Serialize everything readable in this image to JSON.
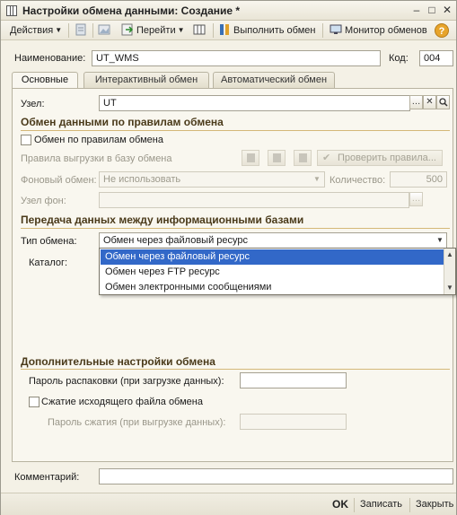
{
  "window": {
    "title": "Настройки обмена данными: Создание *",
    "controls": {
      "minimize": "–",
      "maximize": "□",
      "close": "✕"
    }
  },
  "toolbar": {
    "actions_label": "Действия",
    "goto_label": "Перейти",
    "execute_label": "Выполнить обмен",
    "monitor_label": "Монитор обменов",
    "help_label": "?"
  },
  "header": {
    "name_label": "Наименование:",
    "name_value": "UT_WMS",
    "code_label": "Код:",
    "code_value": "004"
  },
  "tabs": [
    {
      "label": "Основные",
      "active": true
    },
    {
      "label": "Интерактивный обмен",
      "active": false
    },
    {
      "label": "Автоматический обмен",
      "active": false
    }
  ],
  "main": {
    "node_label": "Узел:",
    "node_value": "UT",
    "rules_section": {
      "title": "Обмен данными по правилам обмена",
      "checkbox_label": "Обмен по правилам обмена",
      "checked": false,
      "upload_rules_label": "Правила выгрузки в базу обмена",
      "check_rules_label": "Проверить правила...",
      "bg_exchange_label": "Фоновый обмен:",
      "bg_exchange_value": "Не использовать",
      "quantity_label": "Количество:",
      "quantity_value": "500",
      "bg_node_label": "Узел фон:"
    },
    "transfer_section": {
      "title": "Передача данных между информационными базами",
      "exchange_type_label": "Тип обмена:",
      "exchange_type_value": "Обмен через файловый ресурс",
      "catalog_label": "Каталог:",
      "options": [
        "Обмен через файловый ресурс",
        "Обмен через FTP ресурс",
        "Обмен электронными сообщениями"
      ],
      "selected_index": 0
    },
    "extra_section": {
      "title": "Дополнительные настройки обмена",
      "unpack_password_label": "Пароль распаковки (при загрузке данных):",
      "compress_label": "Сжатие исходящего файла обмена",
      "compress_checked": false,
      "compress_password_label": "Пароль сжатия (при выгрузке данных):"
    }
  },
  "comment": {
    "label": "Комментарий:",
    "value": ""
  },
  "bottom": {
    "ok_label": "OK",
    "save_label": "Записать",
    "close_label": "Закрыть"
  }
}
